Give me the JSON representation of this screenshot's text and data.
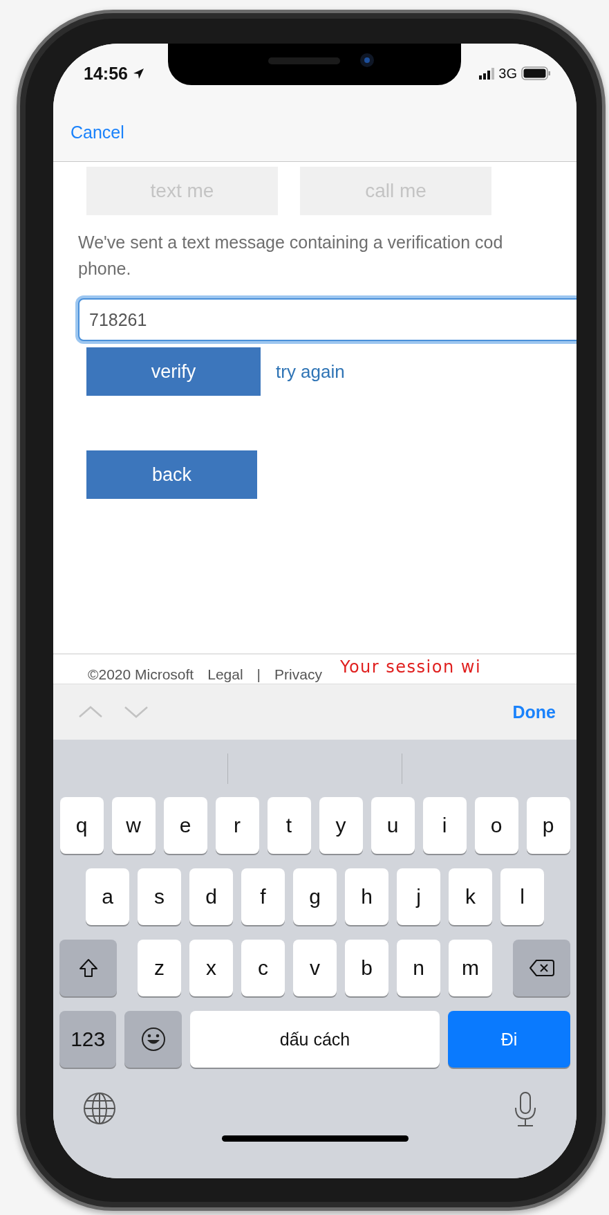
{
  "status_bar": {
    "time": "14:56",
    "network": "3G"
  },
  "nav": {
    "cancel": "Cancel"
  },
  "method_buttons": [
    {
      "label": "text me",
      "disabled": true
    },
    {
      "label": "call me",
      "disabled": true
    }
  ],
  "message_lines": [
    "We've sent a text message containing a verification cod",
    "phone."
  ],
  "code_field": {
    "value": "718261",
    "focused": true
  },
  "verify_button": "verify",
  "try_again": "try again",
  "back_button": "back",
  "footer": {
    "items": [
      "©2020 Microsoft",
      "Legal",
      "|",
      "Privacy"
    ],
    "session_notice": "Your session wi"
  },
  "accessory_bar": {
    "done": "Done"
  },
  "keyboard": {
    "rows": [
      [
        "q",
        "w",
        "e",
        "r",
        "t",
        "y",
        "u",
        "i",
        "o",
        "p"
      ],
      [
        "a",
        "s",
        "d",
        "f",
        "g",
        "h",
        "j",
        "k",
        "l"
      ],
      [
        "z",
        "x",
        "c",
        "v",
        "b",
        "n",
        "m"
      ]
    ],
    "numbers_key": "123",
    "space_key": "dấu cách",
    "return_key": "Đi"
  }
}
